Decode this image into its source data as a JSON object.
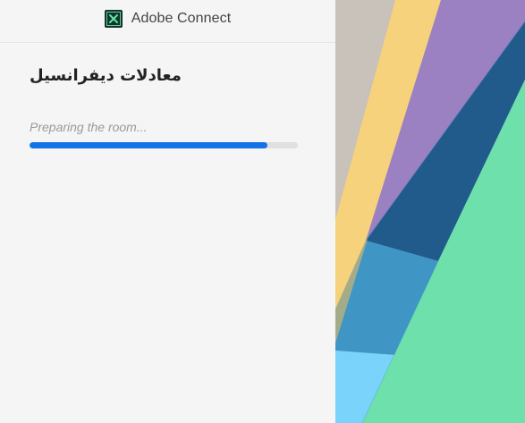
{
  "header": {
    "app_name": "Adobe Connect",
    "logo_icon": "adobe-connect-logo-icon"
  },
  "meeting": {
    "title": "معادلات دیفرانسیل",
    "status_text": "Preparing the room..."
  },
  "loading": {
    "progress_percent": 88.6
  },
  "theme": {
    "background": "#f5f5f5",
    "accent": "#1473e6",
    "art_mint": "#6ee0ab",
    "art_purple": "#9a80c2",
    "art_yellow": "#f6d27b",
    "art_blue": "#4fa1d0",
    "art_navy": "#1e5b8e"
  }
}
